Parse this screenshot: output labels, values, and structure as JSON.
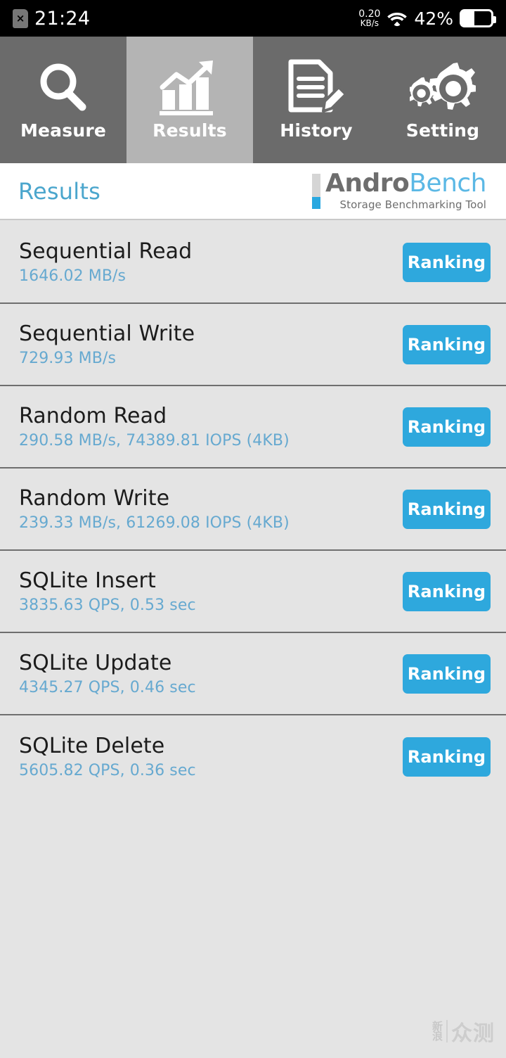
{
  "statusbar": {
    "sim_icon": "sim-card-x-icon",
    "sim_glyph": "×",
    "time": "21:24",
    "net_speed_value": "0.20",
    "net_speed_unit": "KB/s",
    "wifi_icon": "wifi-icon",
    "battery_percent": "42%",
    "battery_level": 42
  },
  "tabs": [
    {
      "label": "Measure",
      "icon": "magnifier-icon",
      "active": false
    },
    {
      "label": "Results",
      "icon": "bar-chart-arrow-icon",
      "active": true
    },
    {
      "label": "History",
      "icon": "document-pencil-icon",
      "active": false
    },
    {
      "label": "Setting",
      "icon": "gears-icon",
      "active": false
    }
  ],
  "header": {
    "title": "Results",
    "logo_primary": "Andro",
    "logo_secondary": "Bench",
    "logo_subtitle": "Storage Benchmarking Tool"
  },
  "results": [
    {
      "name": "Sequential Read",
      "value": "1646.02 MB/s",
      "button": "Ranking"
    },
    {
      "name": "Sequential Write",
      "value": "729.93 MB/s",
      "button": "Ranking"
    },
    {
      "name": "Random Read",
      "value": "290.58 MB/s, 74389.81 IOPS (4KB)",
      "button": "Ranking"
    },
    {
      "name": "Random Write",
      "value": "239.33 MB/s, 61269.08 IOPS (4KB)",
      "button": "Ranking"
    },
    {
      "name": "SQLite Insert",
      "value": "3835.63 QPS, 0.53 sec",
      "button": "Ranking"
    },
    {
      "name": "SQLite Update",
      "value": "4345.27 QPS, 0.46 sec",
      "button": "Ranking"
    },
    {
      "name": "SQLite Delete",
      "value": "5605.82 QPS, 0.36 sec",
      "button": "Ranking"
    }
  ],
  "watermark": {
    "line1": "新",
    "line2": "浪",
    "text": "众测"
  },
  "colors": {
    "accent_blue": "#2ea8dd",
    "title_blue": "#4ba6cd",
    "value_blue": "#66a9d0",
    "tab_inactive": "#6b6b6b",
    "tab_active": "#b4b4b4",
    "list_bg": "#e4e4e4"
  }
}
